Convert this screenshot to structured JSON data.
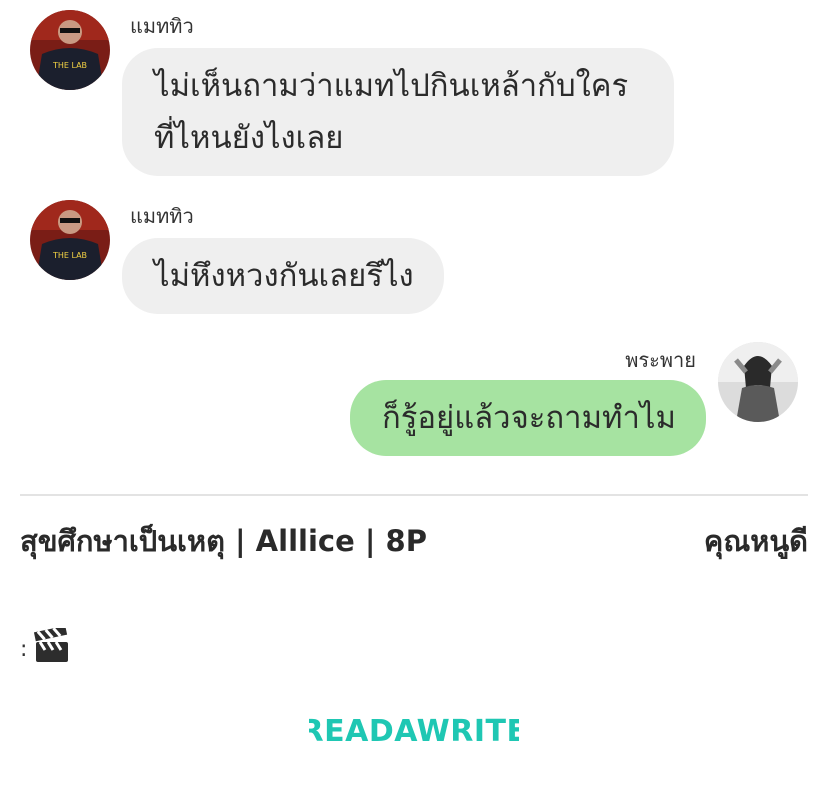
{
  "messages": [
    {
      "sender": "แมททิว",
      "side": "left",
      "lines": [
        "ไม่เห็นถามว่าแมทไปกินเหล้ากับใคร",
        "ที่ไหนยังไงเลย"
      ]
    },
    {
      "sender": "แมททิว",
      "side": "left",
      "lines": [
        "ไม่หึงหวงกันเลยรึไง"
      ]
    },
    {
      "sender": "พระพาย",
      "side": "right",
      "lines": [
        "ก็รู้อยู่แล้วจะถามทำไม"
      ]
    }
  ],
  "avatars": {
    "left_shirt_text": "THE LAB"
  },
  "colors": {
    "incoming_bubble": "#efefef",
    "outgoing_bubble": "#a6e3a1",
    "brand_teal": "#1fc7b3",
    "divider": "#e3e3e3"
  },
  "story": {
    "title": "สุขศึกษาเป็นเหตุ | Alllice | 8P",
    "author": "คุณหนูดี",
    "note_prefix": ":",
    "note_icon": "clapperboard-icon"
  },
  "brand": {
    "logo_text": "READAWRITE"
  }
}
